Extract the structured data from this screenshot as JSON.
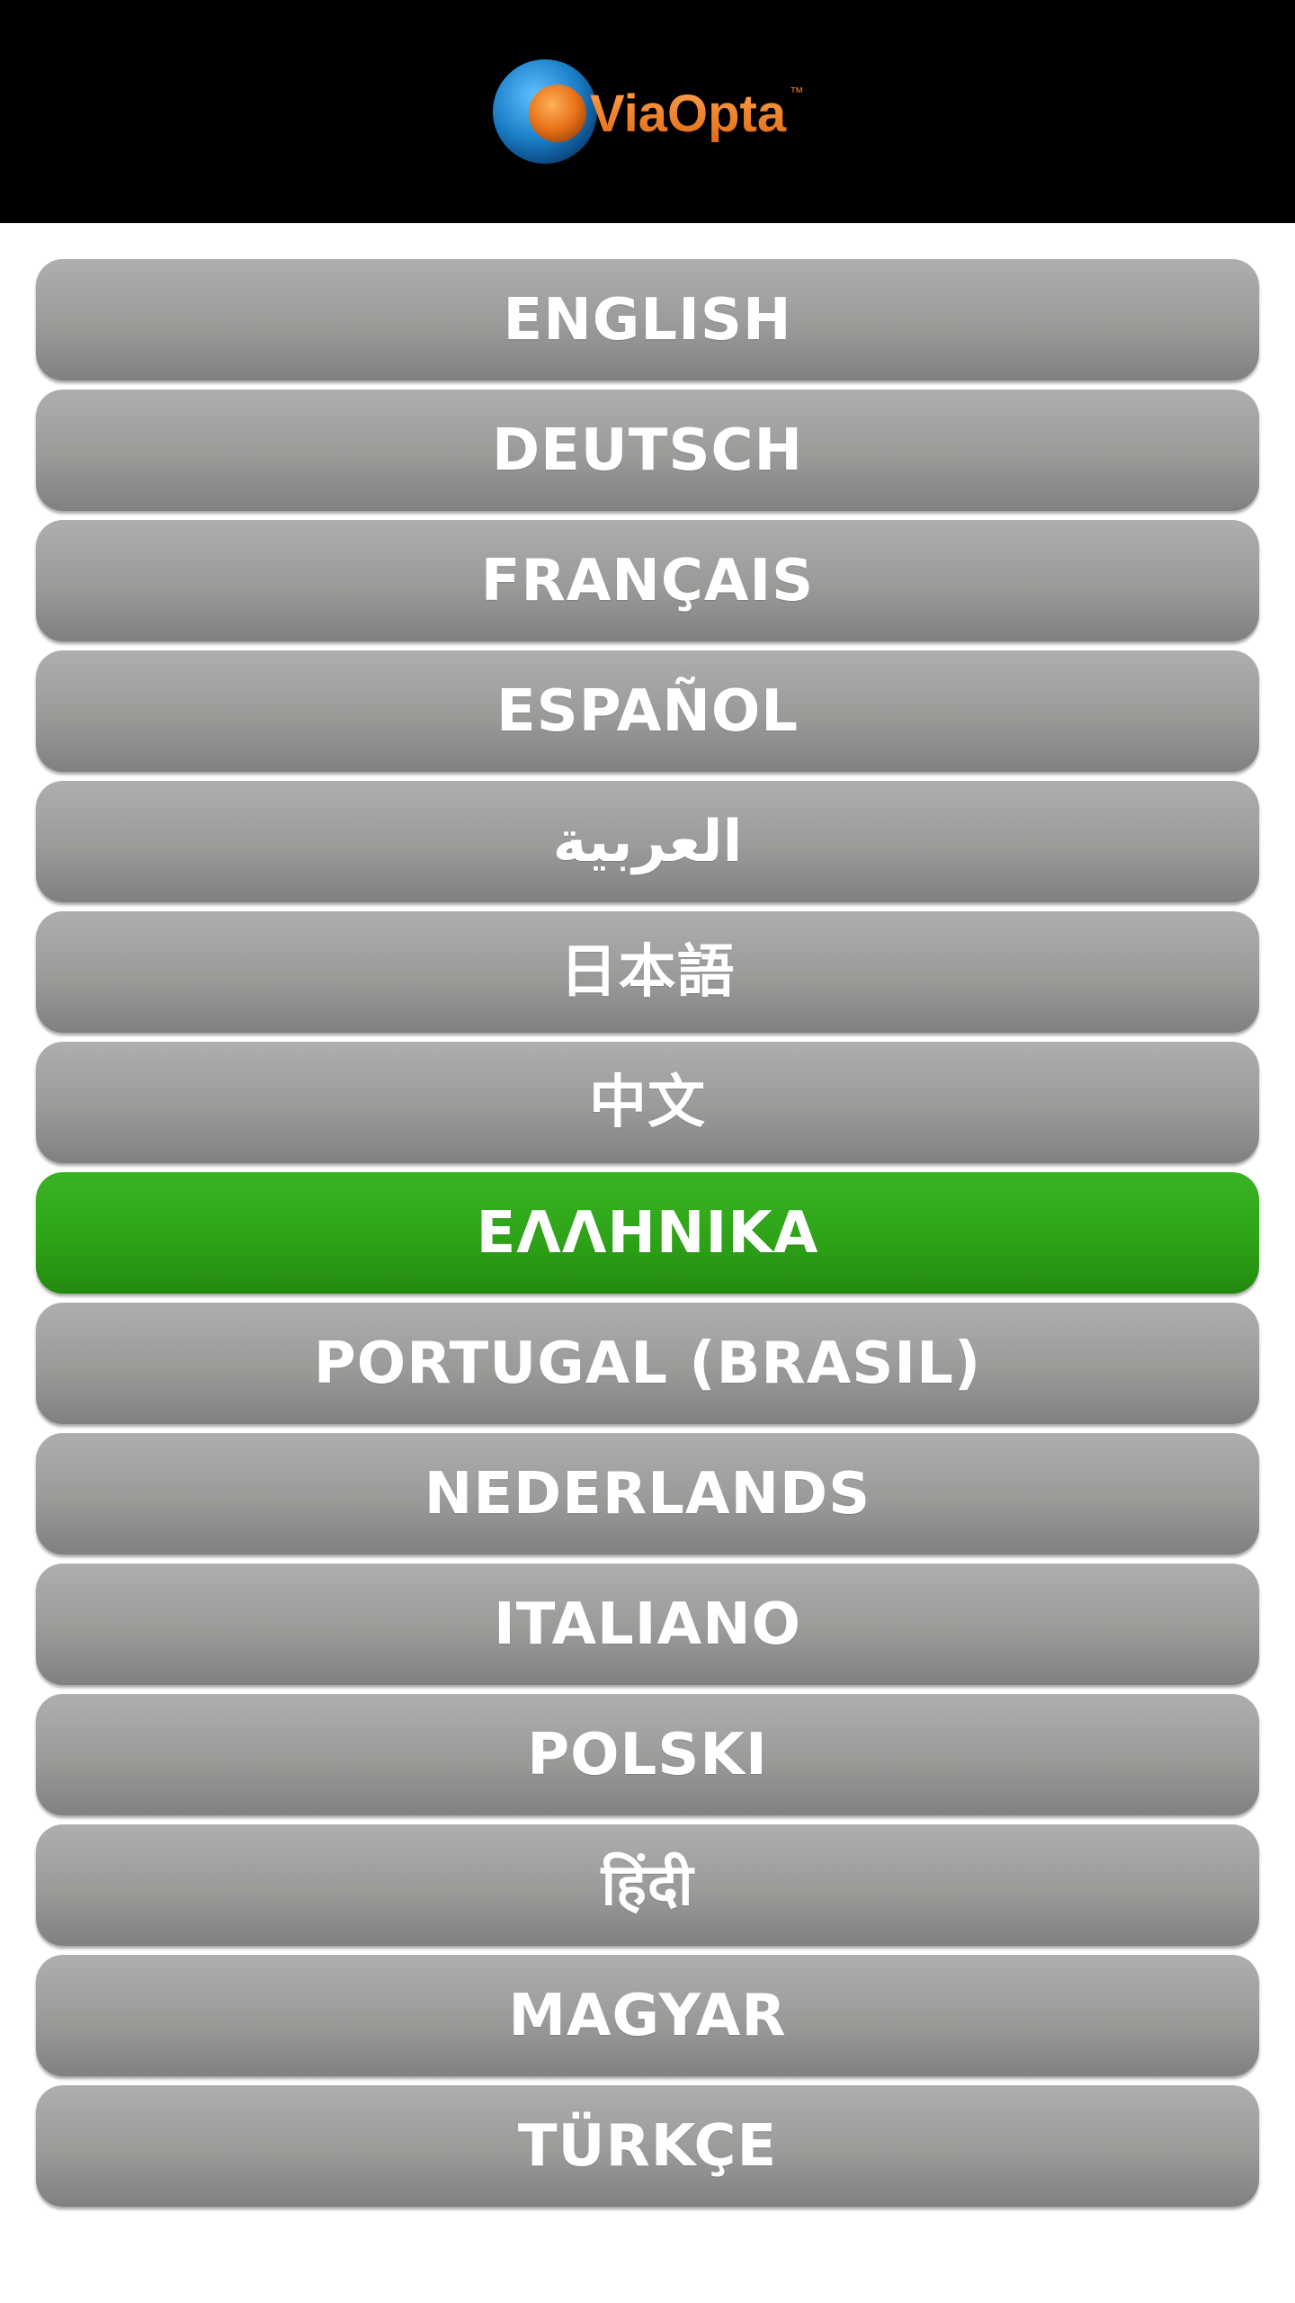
{
  "header": {
    "logo_text": "ViaOpta",
    "logo_trademark": "™"
  },
  "colors": {
    "header_bg": "#000000",
    "button_gray": "#9a9b98",
    "button_selected": "#2ea318",
    "logo_orange": "#e8731a",
    "logo_blue": "#1a7fc8"
  },
  "languages": [
    {
      "label": "ENGLISH",
      "selected": false
    },
    {
      "label": "DEUTSCH",
      "selected": false
    },
    {
      "label": "FRANÇAIS",
      "selected": false
    },
    {
      "label": "ESPAÑOL",
      "selected": false
    },
    {
      "label": "العربية",
      "selected": false
    },
    {
      "label": "日本語",
      "selected": false
    },
    {
      "label": "中文",
      "selected": false
    },
    {
      "label": "ΕΛΛΗΝΙΚΑ",
      "selected": true
    },
    {
      "label": "PORTUGAL (BRASIL)",
      "selected": false
    },
    {
      "label": "NEDERLANDS",
      "selected": false
    },
    {
      "label": "ITALIANO",
      "selected": false
    },
    {
      "label": "POLSKI",
      "selected": false
    },
    {
      "label": "हिंदी",
      "selected": false
    },
    {
      "label": "MAGYAR",
      "selected": false
    },
    {
      "label": "TÜRKÇE",
      "selected": false
    }
  ]
}
